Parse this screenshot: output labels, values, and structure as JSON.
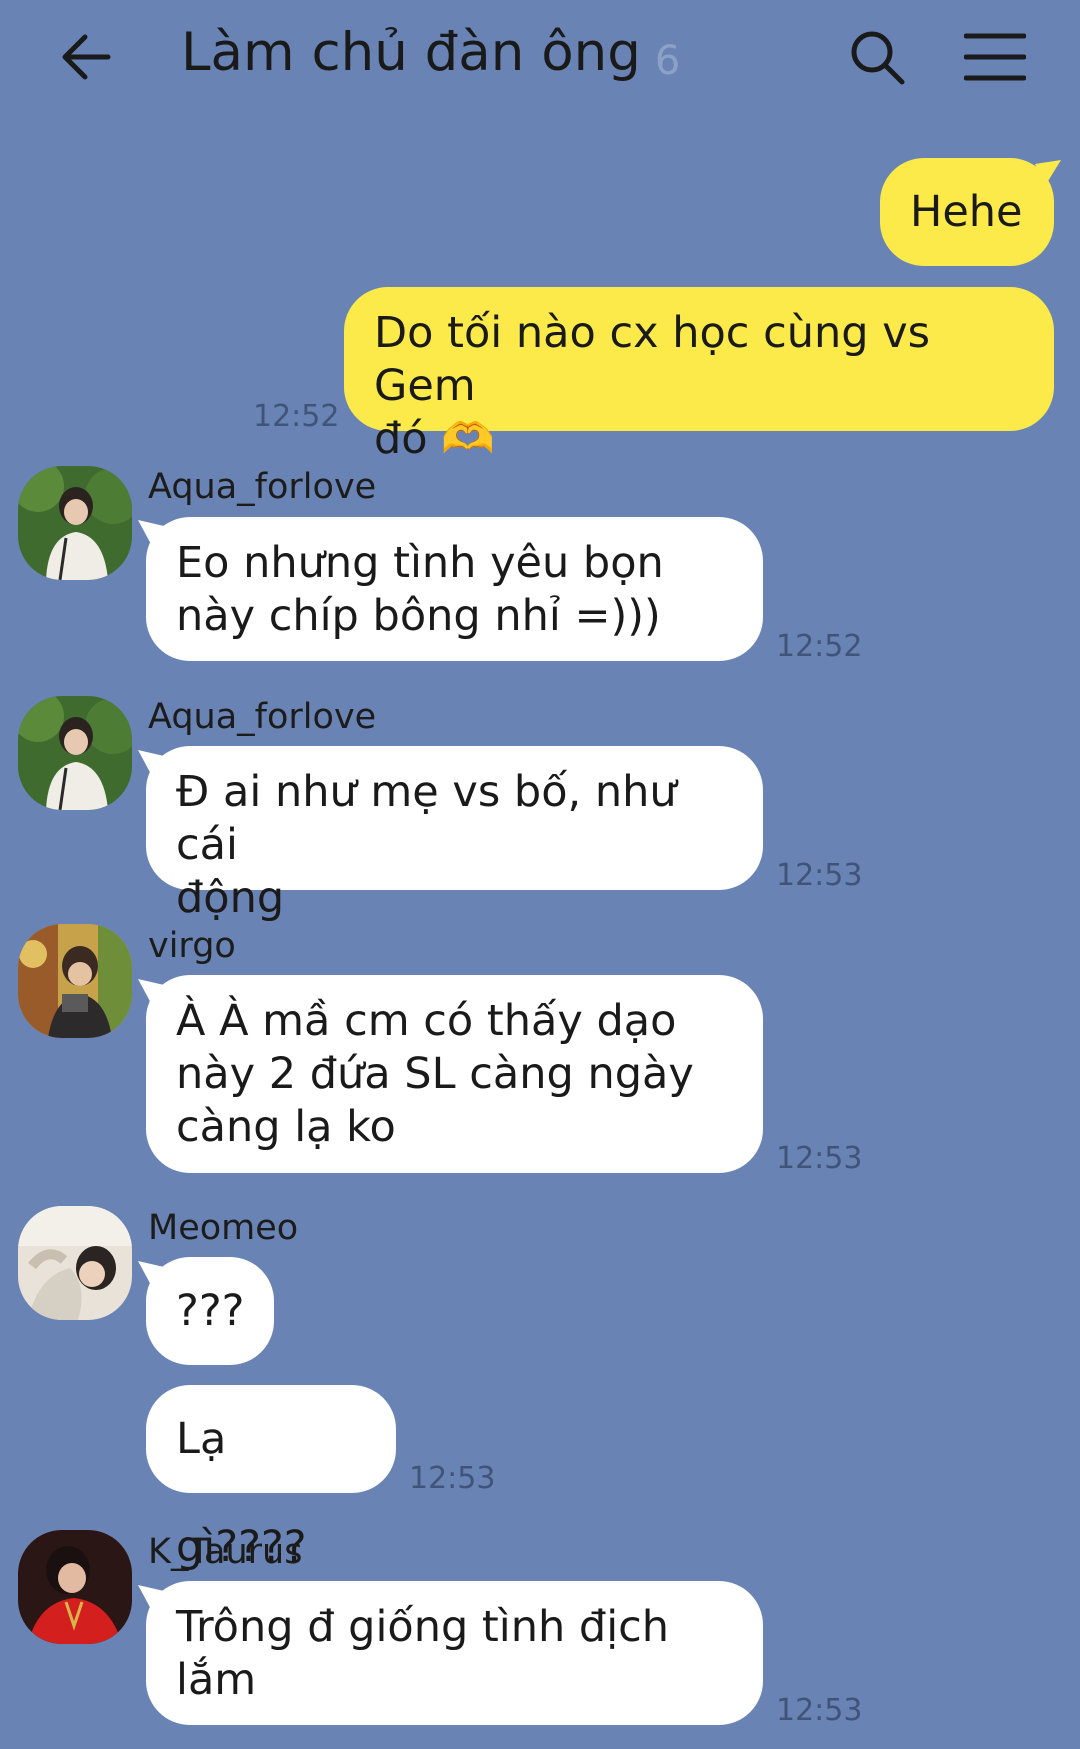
{
  "header": {
    "title": "Làm chủ đàn ông",
    "member_count": "6",
    "icons": {
      "back": "back-arrow-icon",
      "search": "search-icon",
      "menu": "menu-icon"
    }
  },
  "colors": {
    "background": "#6984b4",
    "my_bubble": "#fcea4b",
    "their_bubble": "#ffffff"
  },
  "messages": [
    {
      "sender": "me",
      "text": "Hehe"
    },
    {
      "sender": "me",
      "lines": [
        "Do tối nào cx học cùng vs Gem",
        "đó 🫶"
      ],
      "time": "12:52"
    },
    {
      "sender": "Aqua_forlove",
      "lines": [
        "Eo nhưng tình yêu bọn",
        "này chíp bông nhỉ =)))"
      ],
      "time": "12:52"
    },
    {
      "sender": "Aqua_forlove",
      "lines": [
        "Đ ai như mẹ vs bố, như cái",
        "động"
      ],
      "time": "12:53"
    },
    {
      "sender": "virgo",
      "lines": [
        "À À mầ cm có thấy dạo",
        "này 2 đứa SL càng ngày",
        "càng lạ ko"
      ],
      "time": "12:53"
    },
    {
      "sender": "Meomeo",
      "text": "???"
    },
    {
      "sender": "Meomeo",
      "text": "Lạ gì????",
      "time": "12:53"
    },
    {
      "sender": "K_Taurus",
      "lines": [
        "Trông đ giống tình địch",
        "lắm"
      ],
      "time": "12:53"
    }
  ]
}
